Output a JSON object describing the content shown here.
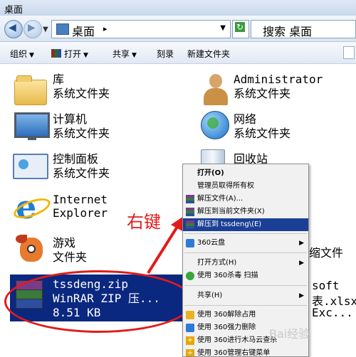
{
  "window": {
    "title": "桌面"
  },
  "address_bar": {
    "location": "桌面",
    "search_text": "搜索 桌面"
  },
  "toolbar": {
    "organize": "组织",
    "open": "打开",
    "share": "共享",
    "burn": "刻录",
    "new_folder": "新建文件夹"
  },
  "desktop_items": {
    "library": {
      "name": "库",
      "type": "系统文件夹"
    },
    "administrator": {
      "name": "Administrator",
      "type": "系统文件夹"
    },
    "computer": {
      "name": "计算机",
      "type": "系统文件夹"
    },
    "network": {
      "name": "网络",
      "type": "系统文件夹"
    },
    "control_panel": {
      "name": "控制面板",
      "type": "系统文件夹"
    },
    "recycle_bin": {
      "name": "回收站"
    },
    "internet_explorer": {
      "line1": "Internet",
      "line2": "Explorer"
    },
    "games": {
      "name": "游戏",
      "type": "文件夹"
    },
    "zip_file": {
      "name": "tssdeng.zip",
      "type": "WinRAR ZIP 压...",
      "size": "8.51 KB"
    }
  },
  "right_peek": {
    "folder_fragment": "缩文件",
    "soft_fragment": "soft",
    "xls_fragment": "表.xlsx",
    "exc_fragment": "Exc..."
  },
  "annotation": {
    "text": "右键"
  },
  "context_menu": {
    "items": [
      "打开(O)",
      "管理员取得所有权",
      "解压文件(A)...",
      "解压到当前文件夹(X)",
      "解压到 tssdeng\\(E)",
      "360云盘",
      "打开方式(H)",
      "使用 360杀毒 扫描",
      "共享(H)",
      "使用 360解除占用",
      "使用 360强力删除",
      "使用 360进行木马云查杀",
      "使用 360管理右键菜单"
    ]
  },
  "watermark": {
    "text": "Bai经验"
  }
}
